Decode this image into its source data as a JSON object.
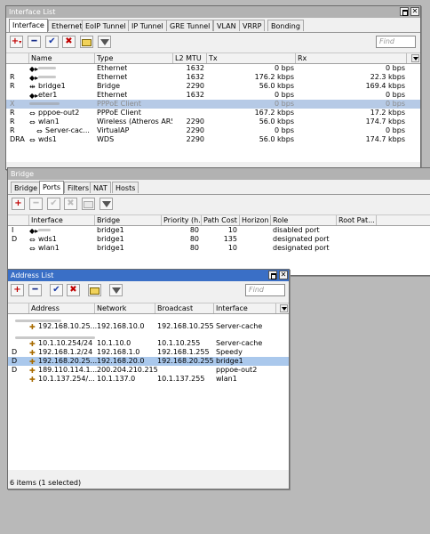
{
  "interface_list": {
    "title": "Interface List",
    "tabs": [
      "Interface",
      "Ethernet",
      "EoIP Tunnel",
      "IP Tunnel",
      "GRE Tunnel",
      "VLAN",
      "VRRP",
      "Bonding"
    ],
    "find_placeholder": "Find",
    "columns": [
      "Name",
      "Type",
      "L2 MTU",
      "Tx",
      "Rx"
    ],
    "rows": [
      {
        "flag": "",
        "name": "",
        "type": "Ethernet",
        "mtu": "1632",
        "tx": "0 bps",
        "rx": "0 bps"
      },
      {
        "flag": "R",
        "name": "",
        "type": "Ethernet",
        "mtu": "1632",
        "tx": "176.2 kbps",
        "rx": "22.3 kbps"
      },
      {
        "flag": "R",
        "name": "bridge1",
        "type": "Bridge",
        "mtu": "2290",
        "tx": "56.0 kbps",
        "rx": "169.4 kbps"
      },
      {
        "flag": "",
        "name": "eter1",
        "type": "Ethernet",
        "mtu": "1632",
        "tx": "0 bps",
        "rx": "0 bps"
      },
      {
        "flag": "X",
        "name": "",
        "type": "PPPoE Client",
        "mtu": "",
        "tx": "0 bps",
        "rx": "0 bps"
      },
      {
        "flag": "R",
        "name": "pppoe-out2",
        "type": "PPPoE Client",
        "mtu": "",
        "tx": "167.2 kbps",
        "rx": "17.2 kbps"
      },
      {
        "flag": "R",
        "name": "wlan1",
        "type": "Wireless (Atheros AR5...",
        "mtu": "2290",
        "tx": "56.0 kbps",
        "rx": "174.7 kbps"
      },
      {
        "flag": "R",
        "name": "Server-cac...",
        "type": "VirtualAP",
        "mtu": "2290",
        "tx": "0 bps",
        "rx": "0 bps"
      },
      {
        "flag": "DRA",
        "name": "wds1",
        "type": "WDS",
        "mtu": "2290",
        "tx": "56.0 kbps",
        "rx": "174.7 kbps"
      }
    ]
  },
  "bridge": {
    "title": "Bridge",
    "tabs": [
      "Bridge",
      "Ports",
      "Filters",
      "NAT",
      "Hosts"
    ],
    "columns": [
      "Interface",
      "Bridge",
      "Priority (h...",
      "Path Cost",
      "Horizon",
      "Role",
      "Root Pat..."
    ],
    "rows": [
      {
        "flag": "I",
        "iface": "",
        "bridge": "bridge1",
        "priority": "80",
        "cost": "10",
        "horizon": "",
        "role": "disabled port"
      },
      {
        "flag": "D",
        "iface": "wds1",
        "bridge": "bridge1",
        "priority": "80",
        "cost": "135",
        "horizon": "",
        "role": "designated port"
      },
      {
        "flag": "",
        "iface": "wlan1",
        "bridge": "bridge1",
        "priority": "80",
        "cost": "10",
        "horizon": "",
        "role": "designated port"
      }
    ]
  },
  "address_list": {
    "title": "Address List",
    "find_placeholder": "Find",
    "columns": [
      "Address",
      "Network",
      "Broadcast",
      "Interface"
    ],
    "rows": [
      {
        "flag": "",
        "address": "",
        "network": "",
        "broadcast": "",
        "iface": ""
      },
      {
        "flag": "",
        "address": "192.168.10.25...",
        "network": "192.168.10.0",
        "broadcast": "192.168.10.255",
        "iface": "Server-cache"
      },
      {
        "flag": "",
        "address": "",
        "network": "",
        "broadcast": "",
        "iface": ""
      },
      {
        "flag": "",
        "address": "10.1.10.254/24",
        "network": "10.1.10.0",
        "broadcast": "10.1.10.255",
        "iface": "Server-cache"
      },
      {
        "flag": "D",
        "address": "192.168.1.2/24",
        "network": "192.168.1.0",
        "broadcast": "192.168.1.255",
        "iface": "Speedy"
      },
      {
        "flag": "D",
        "address": "192.168.20.25...",
        "network": "192.168.20.0",
        "broadcast": "192.168.20.255",
        "iface": "bridge1"
      },
      {
        "flag": "D",
        "address": "189.110.114.1...",
        "network": "200.204.210.215",
        "broadcast": "",
        "iface": "pppoe-out2"
      },
      {
        "flag": "",
        "address": "10.1.137.254/...",
        "network": "10.1.137.0",
        "broadcast": "10.1.137.255",
        "iface": "wlan1"
      }
    ],
    "status": "6 items (1 selected)"
  },
  "colors": {
    "active_title": "#3a6fc6",
    "inactive_title": "#b2b2b2",
    "selection": "#aac8ec",
    "desktop": "#b9b9b9"
  }
}
